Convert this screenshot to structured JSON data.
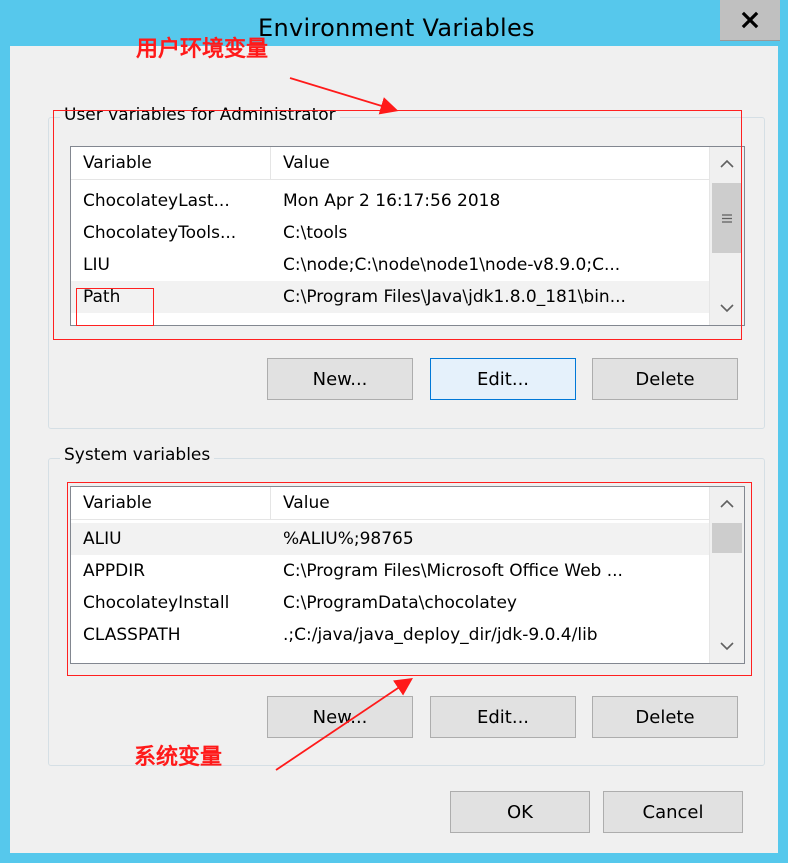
{
  "window": {
    "title": "Environment Variables"
  },
  "user_group": {
    "title": "User variables for Administrator",
    "headers": {
      "variable": "Variable",
      "value": "Value"
    },
    "rows": [
      {
        "variable": "ChocolateyLast...",
        "value": "Mon Apr  2 16:17:56 2018"
      },
      {
        "variable": "ChocolateyTools...",
        "value": "C:\\tools"
      },
      {
        "variable": "LIU",
        "value": "C:\\node;C:\\node\\node1\\node-v8.9.0;C..."
      },
      {
        "variable": "Path",
        "value": "C:\\Program Files\\Java\\jdk1.8.0_181\\bin..."
      }
    ],
    "buttons": {
      "new": "New...",
      "edit": "Edit...",
      "delete": "Delete"
    }
  },
  "system_group": {
    "title": "System variables",
    "headers": {
      "variable": "Variable",
      "value": "Value"
    },
    "rows": [
      {
        "variable": "ALIU",
        "value": "%ALIU%;98765"
      },
      {
        "variable": "APPDIR",
        "value": "C:\\Program Files\\Microsoft Office Web ..."
      },
      {
        "variable": "ChocolateyInstall",
        "value": "C:\\ProgramData\\chocolatey"
      },
      {
        "variable": "CLASSPATH",
        "value": ".;C:/java/java_deploy_dir/jdk-9.0.4/lib"
      }
    ],
    "buttons": {
      "new": "New...",
      "edit": "Edit...",
      "delete": "Delete"
    }
  },
  "footer": {
    "ok": "OK",
    "cancel": "Cancel"
  },
  "annotations": {
    "user_label": "用户环境变量",
    "system_label": "系统变量",
    "color": "#ff1a1a"
  },
  "icons": {
    "close": "close-icon",
    "scroll_up": "chevron-up-icon",
    "scroll_down": "chevron-down-icon",
    "grip": "scroll-grip-icon"
  }
}
